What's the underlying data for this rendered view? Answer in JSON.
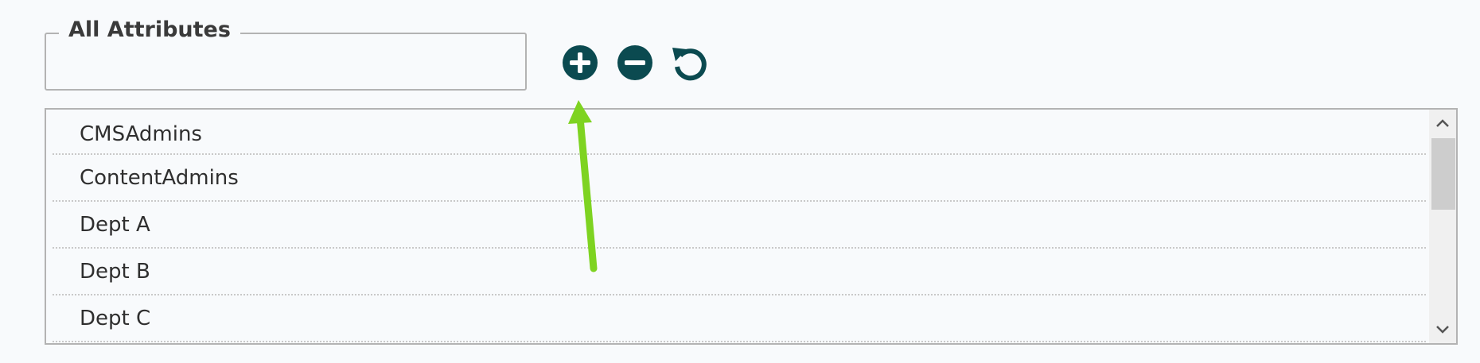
{
  "attributes": {
    "legend": "All Attributes",
    "search_value": "",
    "search_placeholder": ""
  },
  "actions": {
    "add_icon": "plus-circle-icon",
    "remove_icon": "minus-circle-icon",
    "reset_icon": "rotate-ccw-icon",
    "icon_color": "#0b4a50"
  },
  "list": {
    "items": [
      {
        "label": "CMSAdmins"
      },
      {
        "label": "ContentAdmins"
      },
      {
        "label": "Dept A"
      },
      {
        "label": "Dept B"
      },
      {
        "label": "Dept C"
      }
    ]
  },
  "annotation": {
    "arrow_color": "#7ed321"
  }
}
